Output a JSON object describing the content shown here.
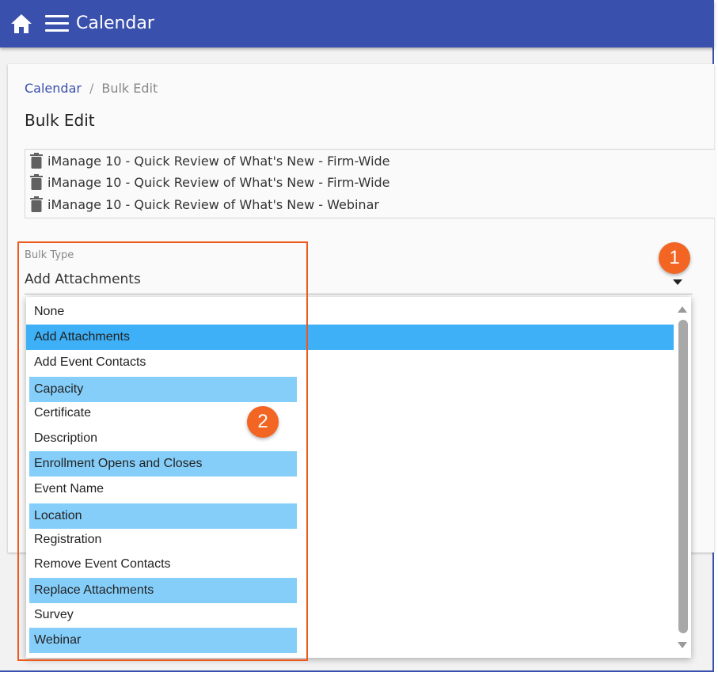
{
  "header": {
    "title": "Calendar",
    "bg_color": "#3a50ad",
    "home_icon": "home-icon",
    "menu_icon": "hamburger-menu-icon"
  },
  "breadcrumb": {
    "link": "Calendar",
    "separator": "/",
    "current": "Bulk Edit"
  },
  "page_title": "Bulk Edit",
  "events": [
    {
      "icon": "trash-icon",
      "name": "iManage 10 - Quick Review of What's New - Firm-Wide"
    },
    {
      "icon": "trash-icon",
      "name": "iManage 10 - Quick Review of What's New - Firm-Wide"
    },
    {
      "icon": "trash-icon",
      "name": "iManage 10 - Quick Review of What's New - Webinar"
    }
  ],
  "bulk_type": {
    "label": "Bulk Type",
    "value": "Add Attachments",
    "options": [
      "None",
      "Add Attachments",
      "Add Event Contacts",
      "Capacity",
      "Certificate",
      "Description",
      "Enrollment Opens and Closes",
      "Event Name",
      "Location",
      "Registration",
      "Remove Event Contacts",
      "Replace Attachments",
      "Survey",
      "Webinar"
    ],
    "selected_color": "#3db0f7",
    "highlight_color": "#85cefa"
  },
  "annotations": {
    "badge_1": "1",
    "badge_2": "2",
    "color": "#f26522"
  }
}
